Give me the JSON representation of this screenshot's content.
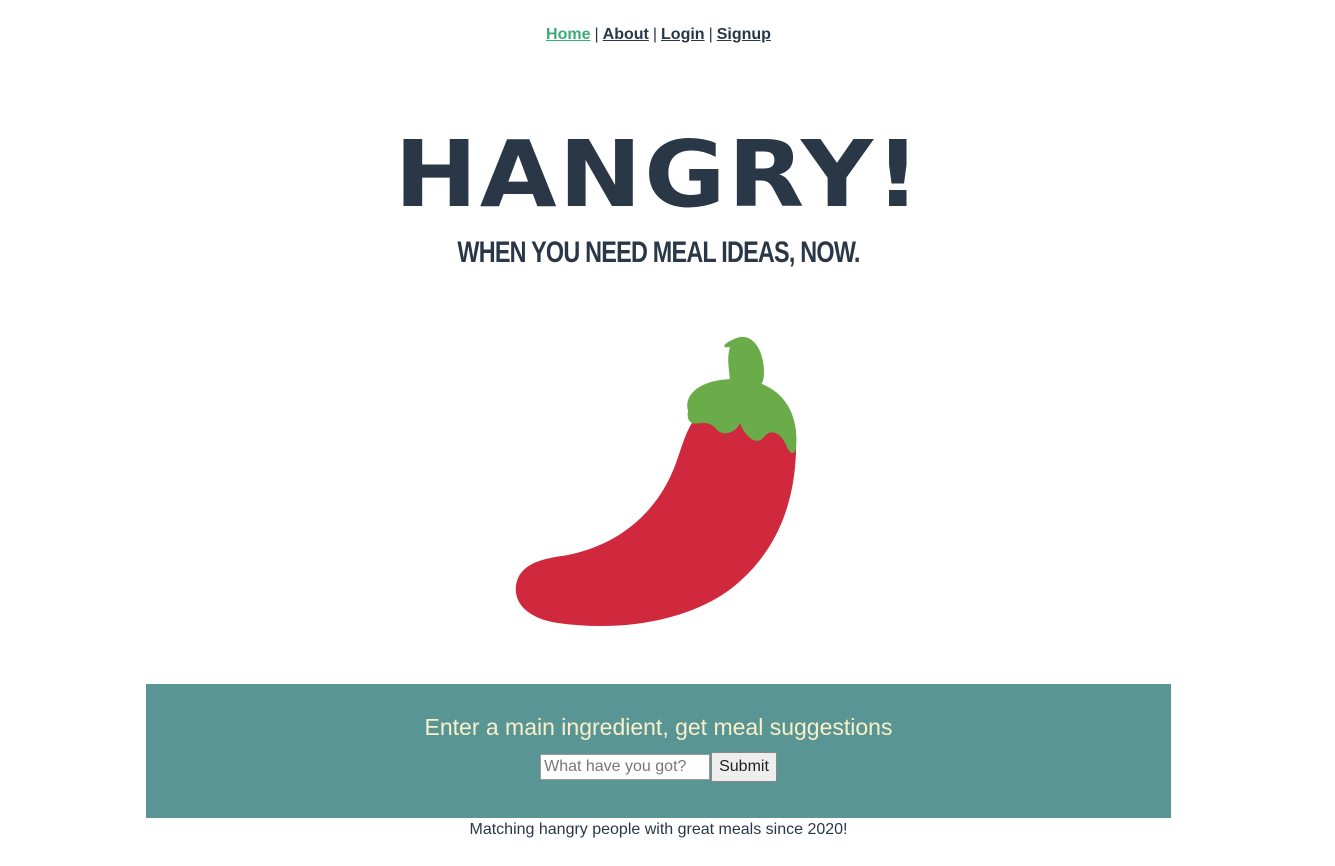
{
  "nav": {
    "items": [
      {
        "label": "Home",
        "active": true
      },
      {
        "label": "About",
        "active": false
      },
      {
        "label": "Login",
        "active": false
      },
      {
        "label": "Signup",
        "active": false
      }
    ],
    "separator": "|"
  },
  "hero": {
    "title": "HANGRY!",
    "subtitle": "WHEN YOU NEED MEAL IDEAS, NOW.",
    "image_icon": "chili-pepper-icon"
  },
  "search": {
    "heading": "Enter a main ingredient, get meal suggestions",
    "placeholder": "What have you got?",
    "value": "",
    "submit_label": "Submit"
  },
  "footer": {
    "text": "Matching hangry people with great meals since 2020!"
  },
  "colors": {
    "text_dark": "#2a3746",
    "nav_active": "#3daa7a",
    "panel_bg": "#5a9595",
    "panel_heading": "#f7f0c8",
    "pepper_red": "#d0283c",
    "pepper_stem": "#6aac4a"
  }
}
